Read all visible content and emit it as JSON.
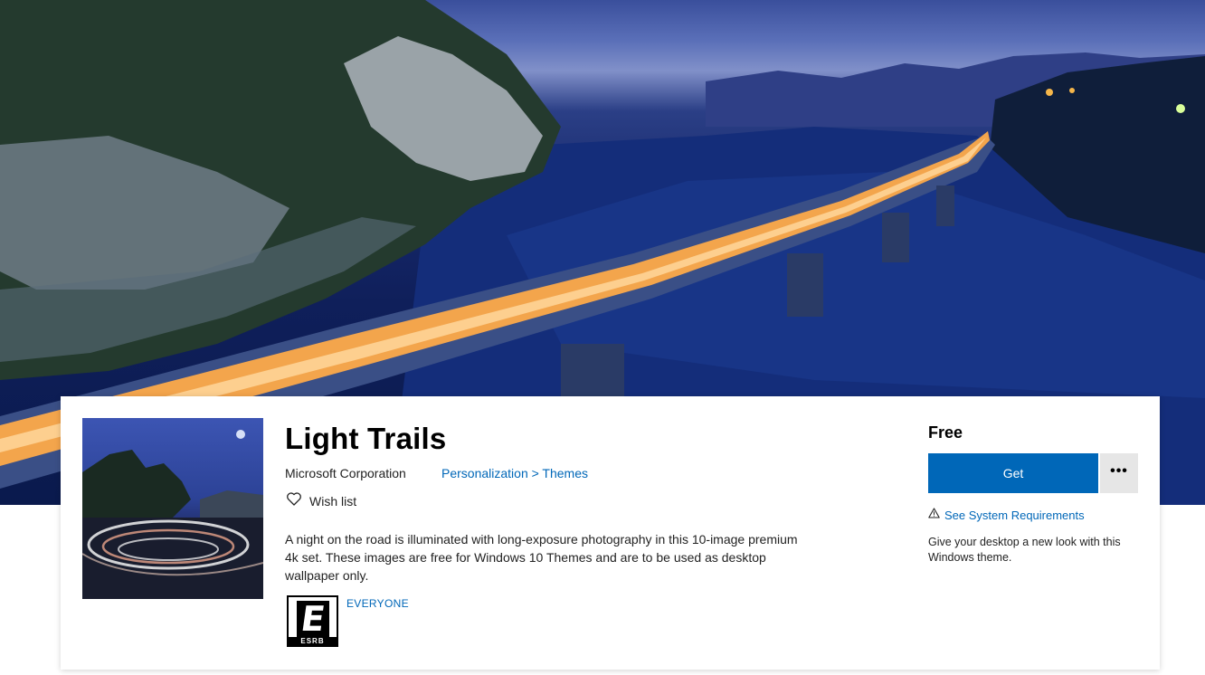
{
  "hero": {
    "image": "Night highway bridge with light trails over a lake"
  },
  "product": {
    "title": "Light Trails",
    "publisher": "Microsoft Corporation",
    "category": "Personalization > Themes",
    "wishlist_label": "Wish list",
    "description": "A night on the road is illuminated with long-exposure photography in this 10-image premium 4k set. These images are free for Windows 10 Themes and are to be used as desktop wallpaper only.",
    "rating": {
      "letter": "E",
      "org": "ESRB",
      "label": "EVERYONE"
    }
  },
  "purchase": {
    "price": "Free",
    "get_label": "Get",
    "more_label": "•••",
    "sysreq_label": "See System Requirements",
    "tagline": "Give your desktop a new look with this Windows theme."
  },
  "colors": {
    "accent": "#0067b8",
    "button_secondary": "#e6e6e6"
  },
  "icons": {
    "wishlist": "heart-outline-icon",
    "sysreq": "warning-triangle-icon",
    "more": "ellipsis-icon"
  }
}
